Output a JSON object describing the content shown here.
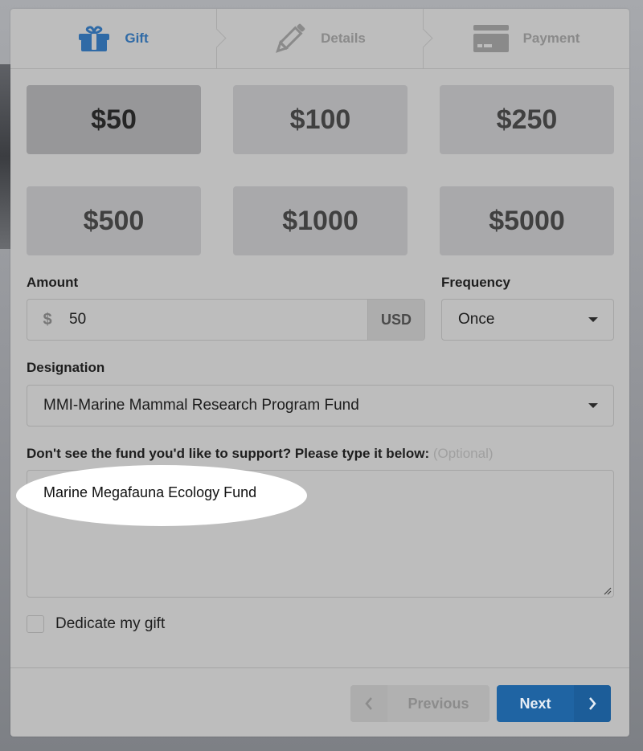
{
  "steps": [
    {
      "label": "Gift",
      "icon": "gift-icon",
      "active": true
    },
    {
      "label": "Details",
      "icon": "pencil-icon",
      "active": false
    },
    {
      "label": "Payment",
      "icon": "credit-card-icon",
      "active": false
    }
  ],
  "amount_options": [
    {
      "label": "$50",
      "selected": true
    },
    {
      "label": "$100",
      "selected": false
    },
    {
      "label": "$250",
      "selected": false
    },
    {
      "label": "$500",
      "selected": false
    },
    {
      "label": "$1000",
      "selected": false
    },
    {
      "label": "$5000",
      "selected": false
    }
  ],
  "amount": {
    "label": "Amount",
    "prefix": "$",
    "value": "50",
    "currency": "USD"
  },
  "frequency": {
    "label": "Frequency",
    "value": "Once"
  },
  "designation": {
    "label": "Designation",
    "value": "MMI-Marine Mammal Research Program Fund"
  },
  "custom_fund": {
    "label": "Don't see the fund you'd like to support? Please type it below:",
    "optional": "(Optional)",
    "value": "Marine Megafauna Ecology Fund"
  },
  "dedicate": {
    "label": "Dedicate my gift",
    "checked": false
  },
  "footer": {
    "previous_label": "Previous",
    "next_label": "Next"
  },
  "colors": {
    "accent": "#2f6aa6",
    "next_button": "#1f64a3"
  }
}
